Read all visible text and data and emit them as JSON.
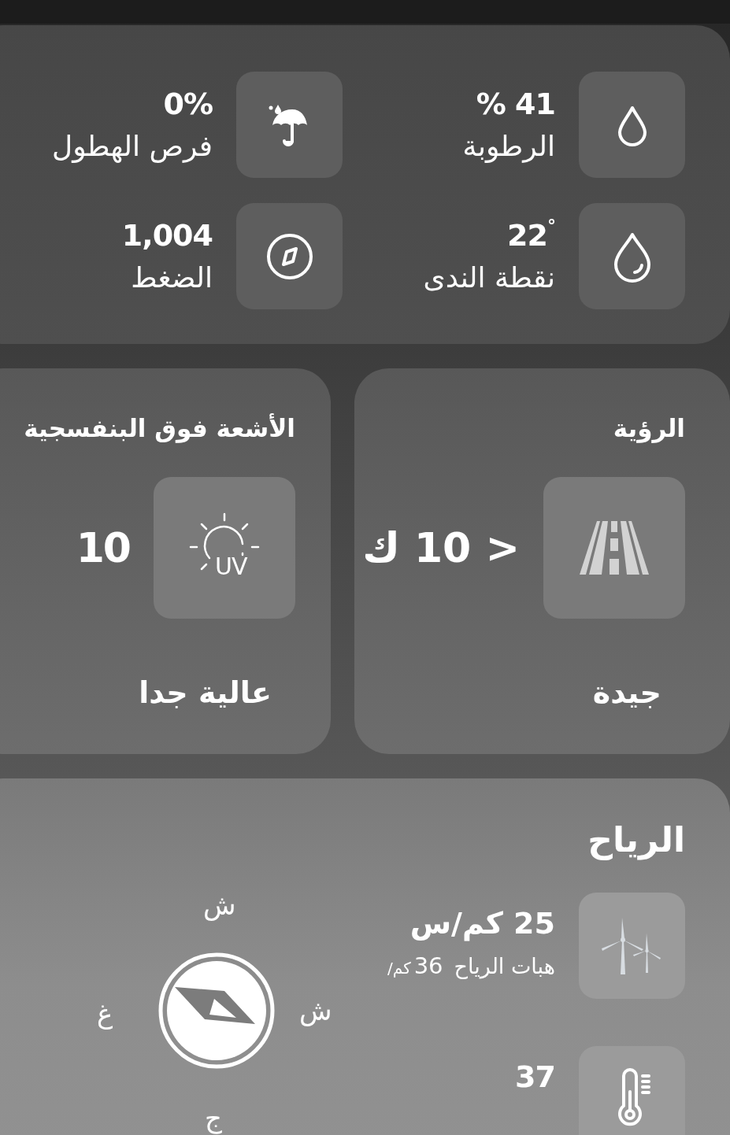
{
  "details": [
    {
      "kind": "humidity",
      "value": "% 41",
      "label": "الرطوبة"
    },
    {
      "kind": "rain",
      "value": "0%",
      "label": "فرص الهطول"
    },
    {
      "kind": "dew",
      "value": "22$^{°}$",
      "label": "نقطة الندى"
    },
    {
      "kind": "pressure",
      "value": "1,004",
      "label": "الضغط"
    }
  ],
  "cards": [
    {
      "kind": "visibility",
      "title": "الرؤية",
      "value": "> 10 ك",
      "rating": "جيدة"
    },
    {
      "kind": "uv",
      "title": "الأشعة فوق البنفسجية",
      "icon_text": "UV",
      "value": "10",
      "rating": "عالية جدا"
    }
  ],
  "wind": {
    "title": "الرياح",
    "compass": {
      "north": "ش",
      "east": "ش",
      "west": "غ",
      "south": "ج"
    },
    "rows": [
      {
        "kind": "speed",
        "value": "25 كم/س",
        "gust_label": "هبات الرياح",
        "gust_value": "36",
        "gust_unit": "كم/"
      },
      {
        "kind": "chill",
        "value": "37"
      }
    ]
  }
}
